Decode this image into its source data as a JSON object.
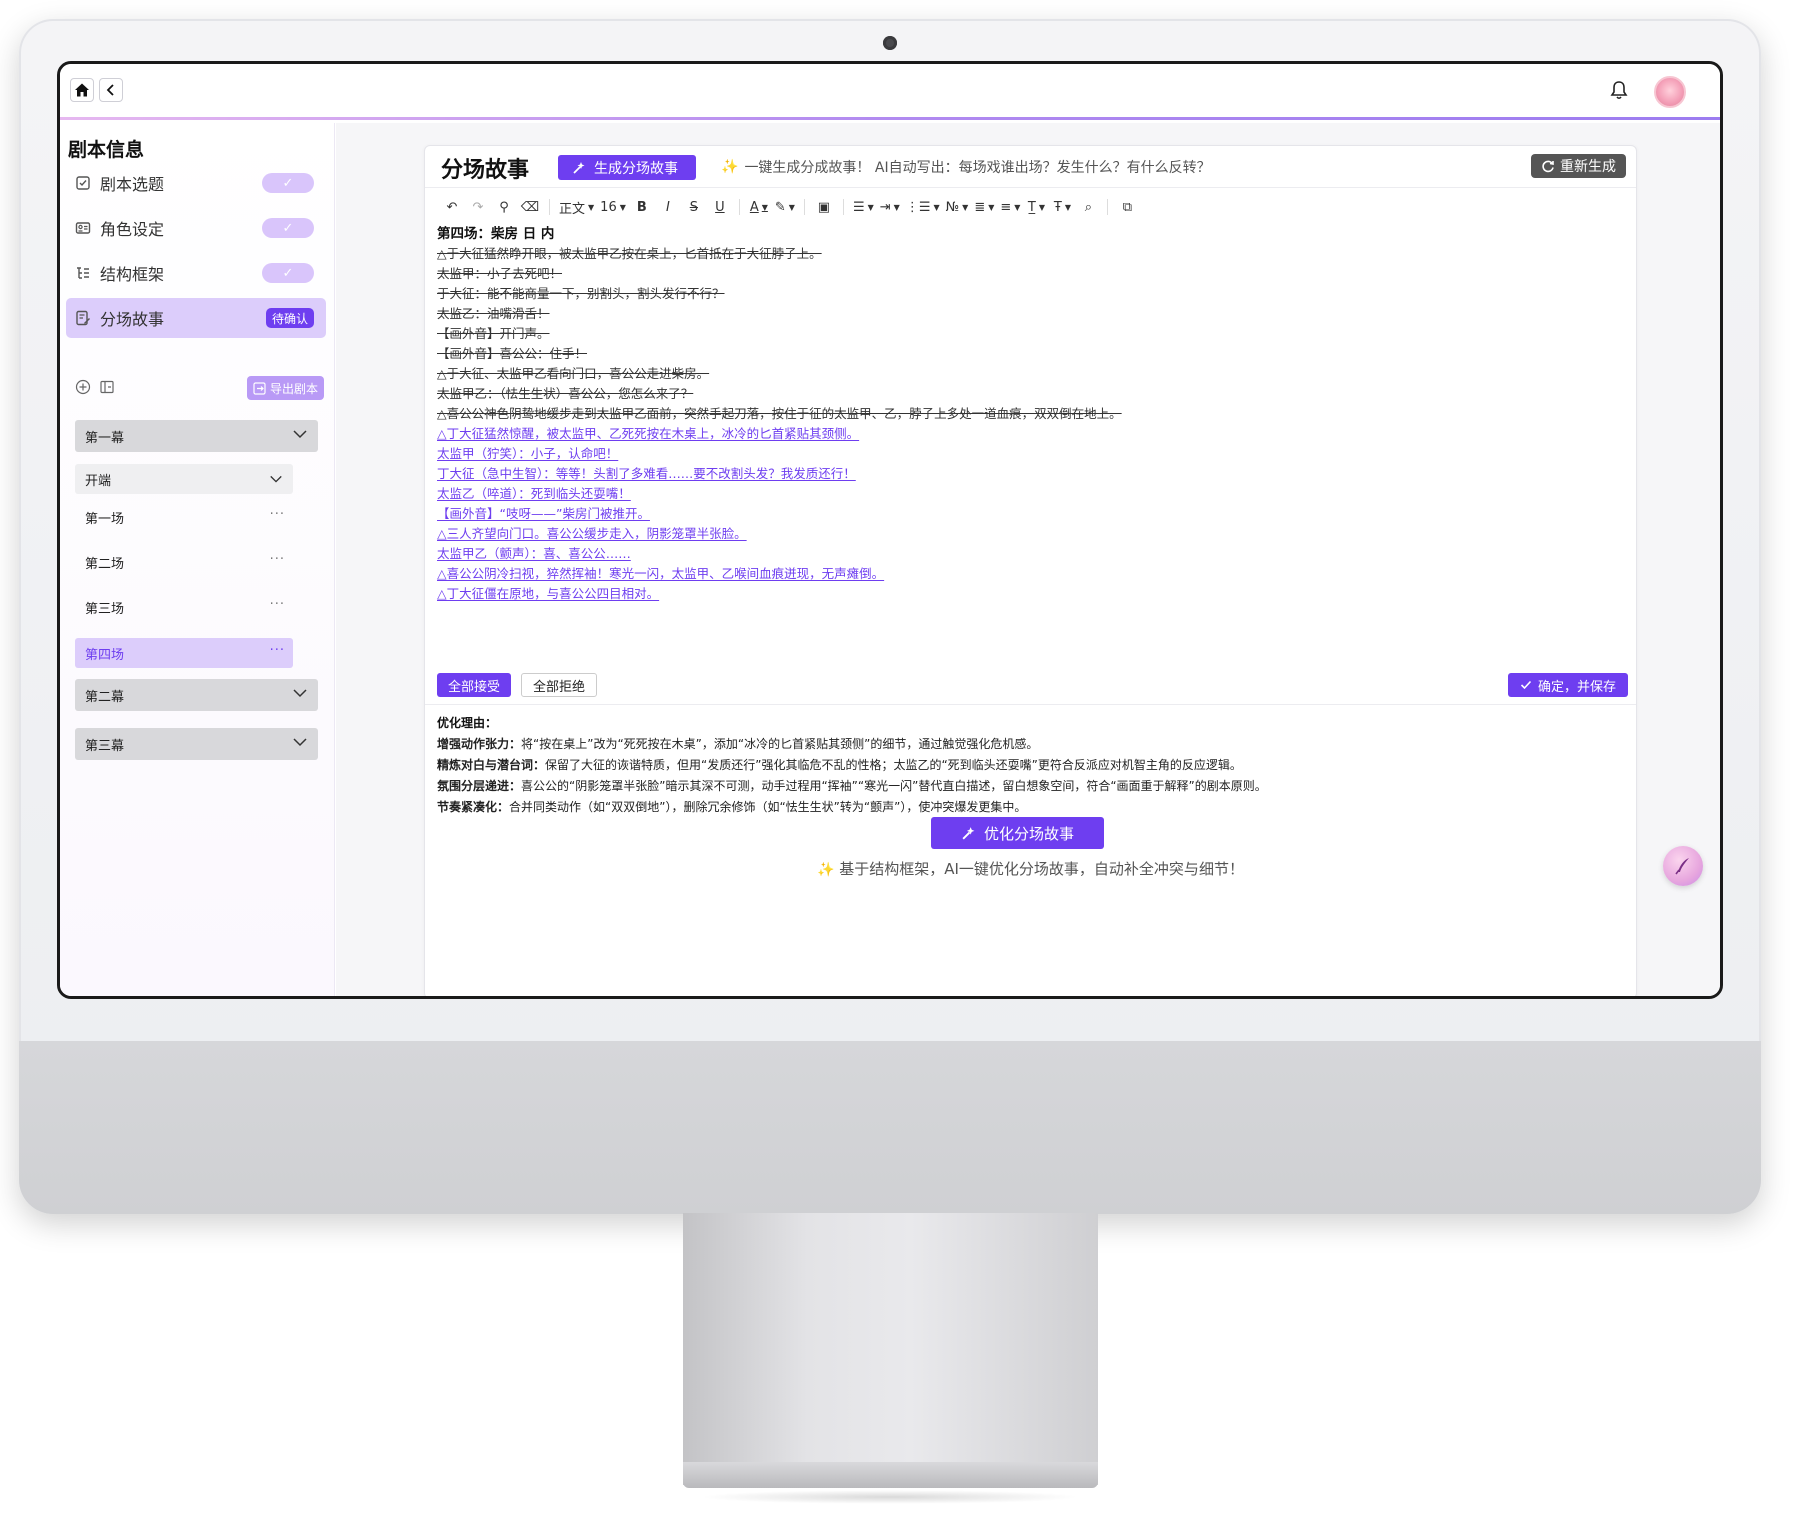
{
  "topbar": {
    "home_icon": "home-icon",
    "back_icon": "chevron-left-icon",
    "bell_icon": "bell-icon"
  },
  "sidebar": {
    "title": "剧本信息",
    "steps": [
      {
        "label": "剧本选题",
        "icon": "checklist-icon",
        "status": "✓"
      },
      {
        "label": "角色设定",
        "icon": "id-card-icon",
        "status": "✓"
      },
      {
        "label": "结构框架",
        "icon": "tree-icon",
        "status": "✓"
      },
      {
        "label": "分场故事",
        "icon": "edit-doc-icon",
        "status": "待确认"
      }
    ],
    "export_label": "导出剧本",
    "acts": [
      "第一幕",
      "第二幕",
      "第三幕"
    ],
    "sub_section": "开端",
    "scenes": [
      "第一场",
      "第二场",
      "第三场",
      "第四场"
    ],
    "scene_menu": "···"
  },
  "panel": {
    "title": "分场故事",
    "generate_label": "生成分场故事",
    "hint": "一键生成分成故事！ AI自动写出：每场戏谁出场？发生什么？有什么反转？",
    "regenerate_label": "重新生成",
    "toolbar": {
      "paragraph": "正文",
      "font_size": "16"
    },
    "lines": [
      {
        "type": "head",
        "text": "第四场：柴房  日 内"
      },
      {
        "type": "del",
        "text": "△于大征猛然睁开眼，被太监甲乙按在桌上，匕首抵在于大征脖子上。"
      },
      {
        "type": "del",
        "text": "太监甲：小子去死吧！"
      },
      {
        "type": "del",
        "text": "于大征：能不能商量一下，别割头，割头发行不行？"
      },
      {
        "type": "del",
        "text": "太监乙：油嘴滑舌！"
      },
      {
        "type": "del",
        "text": "【画外音】开门声。"
      },
      {
        "type": "del",
        "text": "【画外音】喜公公：住手！"
      },
      {
        "type": "del",
        "text": "△于大征、太监甲乙看向门口，喜公公走进柴房。"
      },
      {
        "type": "del",
        "text": "太监甲乙：（怯生生状）喜公公，您怎么来了？"
      },
      {
        "type": "del",
        "text": "△喜公公神色阴鸷地缓步走到太监甲乙面前，突然手起刀落，按住于征的太监甲、乙，脖子上多处一道血痕，双双倒在地上。"
      },
      {
        "type": "ins",
        "text": "△丁大征猛然惊醒，被太监甲、乙死死按在木桌上，冰冷的匕首紧贴其颈侧。"
      },
      {
        "type": "ins",
        "text": "太监甲（狞笑）：小子，认命吧！"
      },
      {
        "type": "ins",
        "text": "丁大征（急中生智）：等等！头割了多难看……要不改割头发？我发质还行！"
      },
      {
        "type": "ins",
        "text": "太监乙（啐道）：死到临头还耍嘴！"
      },
      {
        "type": "ins",
        "text": "【画外音】“吱呀——”柴房门被推开。"
      },
      {
        "type": "ins",
        "text": "△三人齐望向门口。喜公公缓步走入，阴影笼罩半张脸。"
      },
      {
        "type": "ins",
        "text": "太监甲乙（颤声）：喜、喜公公……"
      },
      {
        "type": "ins",
        "text": "△喜公公阴冷扫视，猝然挥袖！寒光一闪，太监甲、乙喉间血痕迸现，无声瘫倒。"
      },
      {
        "type": "ins",
        "text": "△丁大征僵在原地，与喜公公四目相对。"
      }
    ],
    "accept_all": "全部接受",
    "reject_all": "全部拒绝",
    "save_label": "确定，并保存",
    "reason_title": "优化理由：",
    "reasons": [
      {
        "title": "增强动作张力：",
        "text": "将“按在桌上”改为“死死按在木桌”，添加“冰冷的匕首紧贴其颈侧”的细节，通过触觉强化危机感。"
      },
      {
        "title": "精炼对白与潜台词：",
        "text": "保留了大征的诙谐特质，但用“发质还行”强化其临危不乱的性格；太监乙的“死到临头还耍嘴”更符合反派应对机智主角的反应逻辑。"
      },
      {
        "title": "氛围分层递进：",
        "text": "喜公公的“阴影笼罩半张脸”暗示其深不可测，动手过程用“挥袖”“寒光一闪”替代直白描述，留白想象空间，符合“画面重于解释”的剧本原则。"
      },
      {
        "title": "节奏紧凑化：",
        "text": "合并同类动作（如“双双倒地”），删除冗余修饰（如“怯生生状”转为“颤声”），使冲突爆发更集中。"
      }
    ],
    "optimize_label": "优化分场故事",
    "bottom_hint": "基于结构框架，AI一键优化分场故事，自动补全冲突与细节！"
  },
  "colors": {
    "accent": "#6e3ef0",
    "accent_light": "#dccdfb"
  }
}
